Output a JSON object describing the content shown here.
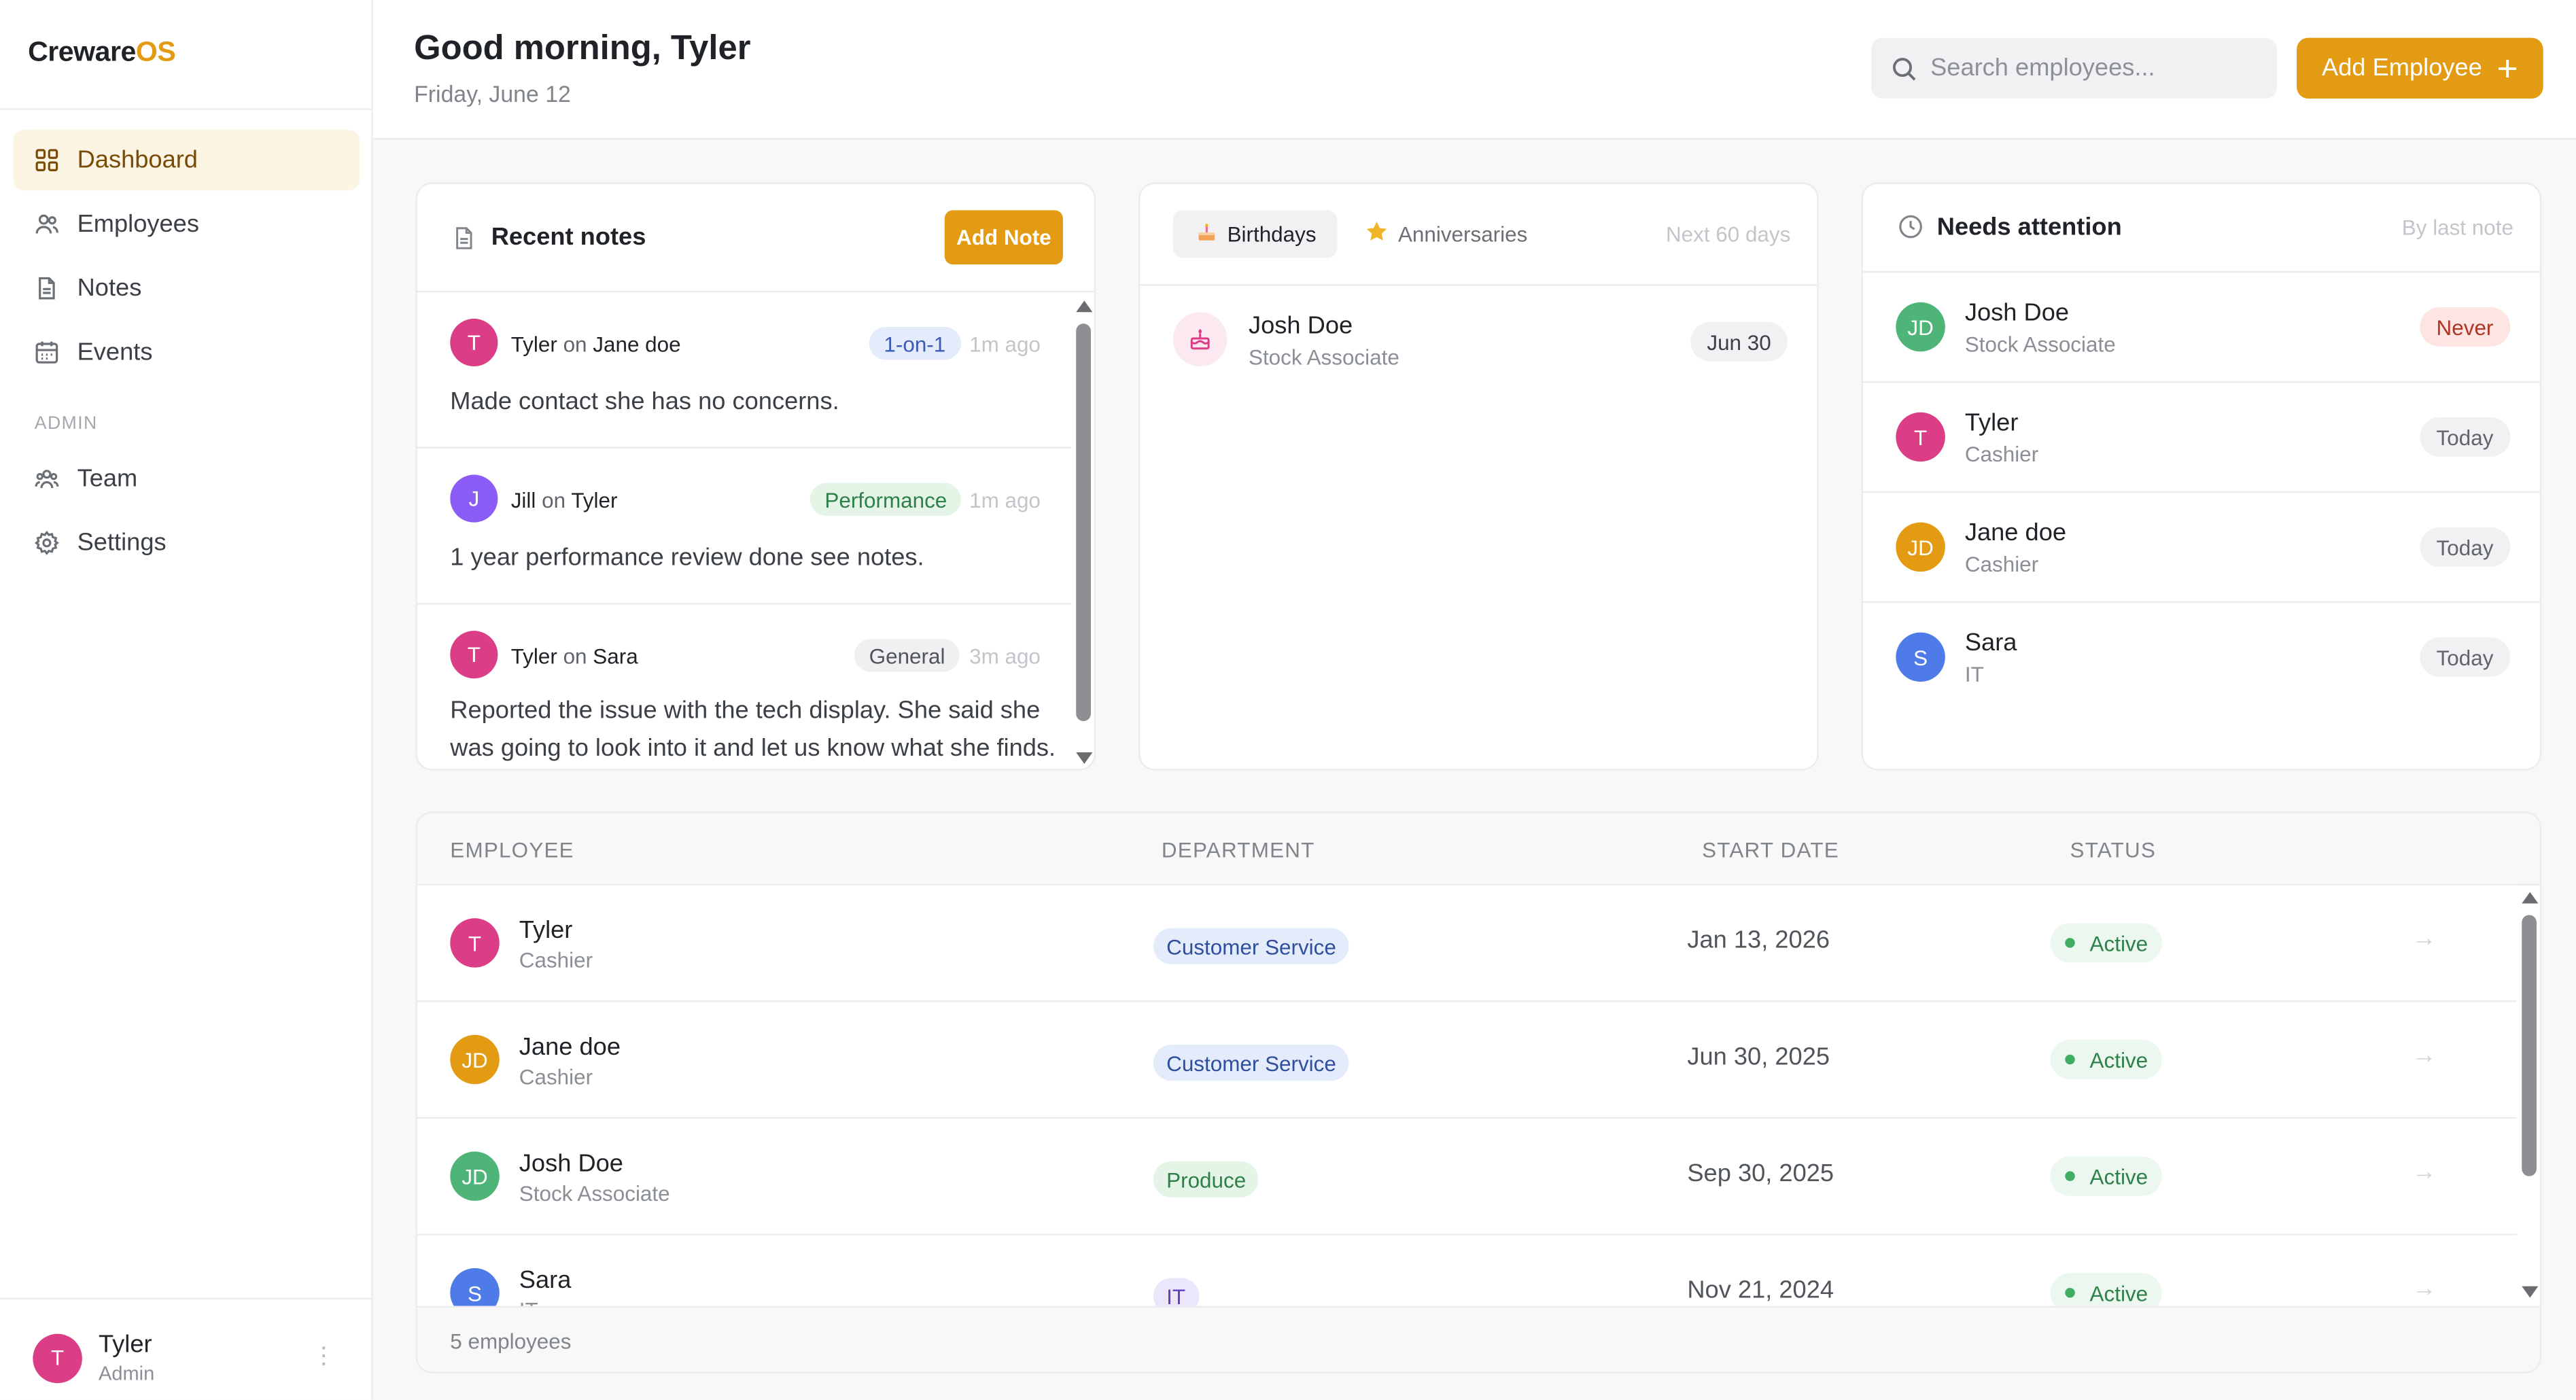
{
  "sidebar": {
    "logo_main": "Creware",
    "logo_accent": "OS",
    "items": [
      {
        "label": "Dashboard",
        "icon": "grid-icon"
      },
      {
        "label": "Employees",
        "icon": "users-icon"
      },
      {
        "label": "Notes",
        "icon": "document-icon"
      },
      {
        "label": "Events",
        "icon": "calendar-icon"
      }
    ],
    "section": "ADMIN",
    "admin_items": [
      {
        "label": "Team",
        "icon": "team-icon"
      },
      {
        "label": "Settings",
        "icon": "gear-icon"
      }
    ],
    "user": {
      "initial": "T",
      "name": "Tyler",
      "role": "Admin"
    }
  },
  "header": {
    "greeting": "Good morning, Tyler",
    "date": "Friday, June 12",
    "search_placeholder": "Search employees...",
    "add_employee": "Add Employee",
    "add_plus": "+"
  },
  "notes": {
    "title": "Recent notes",
    "add_label": "Add Note",
    "on_word": "on",
    "items": [
      {
        "initial": "T",
        "author": "Tyler",
        "subject": "Jane doe",
        "tag": "1-on-1",
        "ago": "1m ago",
        "text": "Made contact she has no concerns."
      },
      {
        "initial": "J",
        "author": "Jill",
        "subject": "Tyler",
        "tag": "Performance",
        "ago": "1m ago",
        "text": "1 year performance review done see notes."
      },
      {
        "initial": "T",
        "author": "Tyler",
        "subject": "Sara",
        "tag": "General",
        "ago": "3m ago",
        "text": "Reported the issue with the tech display. She said she was going to look into it and let us know what she finds."
      }
    ]
  },
  "events": {
    "tab_birthdays": "Birthdays",
    "tab_anniversaries": "Anniversaries",
    "range": "Next 60 days",
    "items": [
      {
        "name": "Josh Doe",
        "role": "Stock Associate",
        "date": "Jun 30"
      }
    ]
  },
  "attention": {
    "title": "Needs attention",
    "sort": "By last note",
    "items": [
      {
        "initials": "JD",
        "name": "Josh Doe",
        "role": "Stock Associate",
        "badge": "Never"
      },
      {
        "initials": "T",
        "name": "Tyler",
        "role": "Cashier",
        "badge": "Today"
      },
      {
        "initials": "JD",
        "name": "Jane doe",
        "role": "Cashier",
        "badge": "Today"
      },
      {
        "initials": "S",
        "name": "Sara",
        "role": "IT",
        "badge": "Today"
      }
    ]
  },
  "table": {
    "columns": [
      "EMPLOYEE",
      "DEPARTMENT",
      "START DATE",
      "STATUS"
    ],
    "rows": [
      {
        "initials": "T",
        "name": "Tyler",
        "role": "Cashier",
        "department": "Customer Service",
        "start": "Jan 13, 2026",
        "status": "Active"
      },
      {
        "initials": "JD",
        "name": "Jane doe",
        "role": "Cashier",
        "department": "Customer Service",
        "start": "Jun 30, 2025",
        "status": "Active"
      },
      {
        "initials": "JD",
        "name": "Josh Doe",
        "role": "Stock Associate",
        "department": "Produce",
        "start": "Sep 30, 2025",
        "status": "Active"
      },
      {
        "initials": "S",
        "name": "Sara",
        "role": "IT",
        "department": "IT",
        "start": "Nov 21, 2024",
        "status": "Active"
      }
    ],
    "row_arrow": "→",
    "footer": "5 employees"
  },
  "colors": {
    "accent": "#e39b14",
    "active_nav_bg": "#fdf5e3"
  }
}
